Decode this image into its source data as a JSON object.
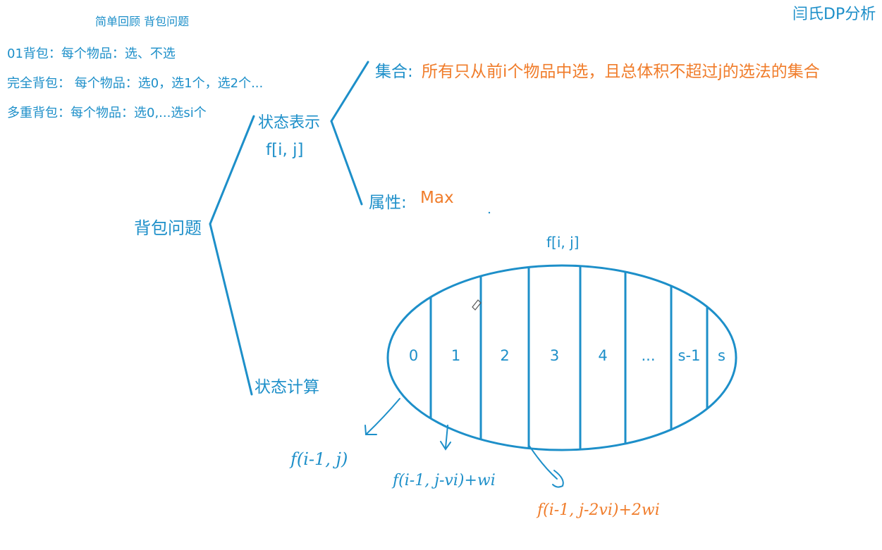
{
  "brand": "闫氏DP分析",
  "review": {
    "title": "简单回顾 背包问题",
    "lines": [
      "01背包：每个物品：选、不选",
      "完全背包： 每个物品：选0，选1个，选2个...",
      "多重背包：每个物品：选0,...选si个"
    ]
  },
  "tree": {
    "root": "背包问题",
    "state_repr": "状态表示",
    "state_var": "f[i, j]",
    "set_label": "集合:",
    "set_desc": "所有只从前i个物品中选，且总体积不超过j的选法的集合",
    "attr_label": "属性:",
    "attr_value": "Max",
    "state_calc": "状态计算"
  },
  "partition": {
    "title": "f[i, j]",
    "cells": [
      "0",
      "1",
      "2",
      "3",
      "4",
      "...",
      "s-1",
      "s"
    ]
  },
  "formulas": [
    "f(i-1, j)",
    "f(i-1, j-vi)+wi",
    "f(i-1, j-2vi)+2wi"
  ],
  "colors": {
    "primary": "#1d8fc9",
    "accent": "#f07c2a"
  }
}
